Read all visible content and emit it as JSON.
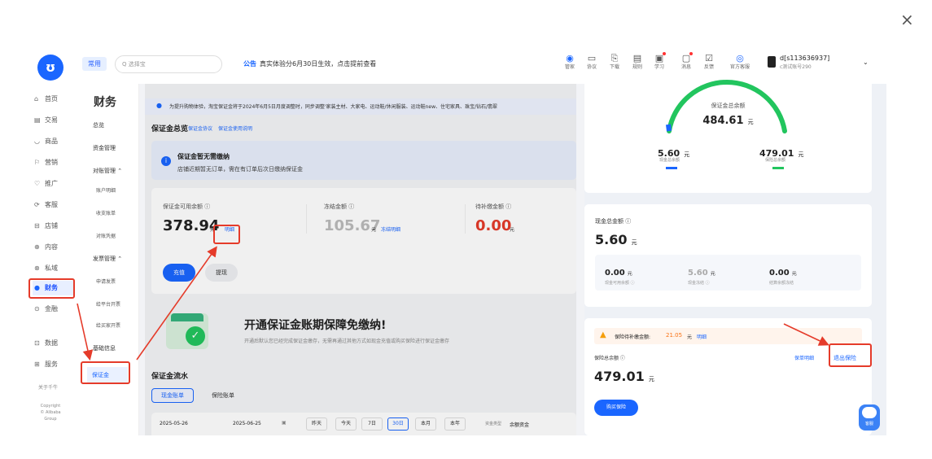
{
  "dialog": {
    "close_label": "×"
  },
  "topbar": {
    "logo": "ʊ",
    "chip": "常用",
    "search_placeholder": "Q 选择宝",
    "notice_label": "公告",
    "notice_text": "真实体验分6月30日生效，点击提前查看",
    "icons": [
      {
        "glyph": "◉",
        "label": "管家",
        "icon": "steward-icon",
        "dot": false,
        "color": "#1a66ff"
      },
      {
        "glyph": "▭",
        "label": "协议",
        "icon": "agreement-icon",
        "dot": false
      },
      {
        "glyph": "⎘",
        "label": "下载",
        "icon": "download-icon",
        "dot": false
      },
      {
        "glyph": "▤",
        "label": "规则",
        "icon": "rules-icon",
        "dot": false
      },
      {
        "glyph": "▣",
        "label": "学习",
        "icon": "learn-icon",
        "dot": true
      },
      {
        "glyph": "▢",
        "label": "消息",
        "icon": "message-icon",
        "dot": true
      },
      {
        "glyph": "☑",
        "label": "反馈",
        "icon": "feedback-icon",
        "dot": false
      },
      {
        "glyph": "◎",
        "label": "官方客服",
        "icon": "service-icon",
        "dot": false,
        "color": "#1a66ff"
      }
    ],
    "user_name": "d[s113636937]",
    "user_sub": "c测试账号290"
  },
  "leftnav": [
    {
      "icon": "⌂",
      "label": "首页",
      "name": "home-icon"
    },
    {
      "icon": "▤",
      "label": "交易",
      "name": "trade-icon"
    },
    {
      "icon": "◡",
      "label": "商品",
      "name": "goods-icon"
    },
    {
      "icon": "⚐",
      "label": "营销",
      "name": "marketing-icon"
    },
    {
      "icon": "♡",
      "label": "推广",
      "name": "promote-icon"
    },
    {
      "icon": "⟳",
      "label": "客服",
      "name": "cs-icon"
    },
    {
      "icon": "⊟",
      "label": "店铺",
      "name": "shop-icon"
    },
    {
      "icon": "⊕",
      "label": "内容",
      "name": "content-icon"
    },
    {
      "icon": "⊗",
      "label": "私域",
      "name": "private-icon"
    },
    {
      "icon": "●",
      "label": "财务",
      "name": "finance-icon",
      "active": true
    },
    {
      "icon": "⊙",
      "label": "金融",
      "name": "finance2-icon"
    },
    {
      "icon": "⊡",
      "label": "数据",
      "name": "data-icon"
    },
    {
      "icon": "⊞",
      "label": "服务",
      "name": "service2-icon"
    }
  ],
  "leftnav_footer": {
    "about": "关于千牛",
    "copyright": "Copyright",
    "alibaba": "© Alibaba",
    "group": "Group"
  },
  "subnav": {
    "title": "财务",
    "items": [
      "总览",
      "资金管理",
      "对账管理 ⌃",
      "账户明细",
      "收支账单",
      "对账凭据",
      "发票管理 ⌃",
      "申请发票",
      "给平台开票",
      "给买家开票",
      "基础信息",
      "保证金"
    ]
  },
  "main": {
    "banner": "为提升购物体验，淘宝保证金将于2024年6月5日月度调整时，同步调整'家装主材、大家电、运动鞋/休闲服装、运动鞋new、住宅家具、珠宝/钻石/翡翠",
    "section_title": "保证金总览",
    "links": [
      "保证金协议",
      "保证金使用说明"
    ],
    "info_title": "保证金暂无需缴纳",
    "info_text": "店铺近期暂无订单，需在有订单后次日缴纳保证金",
    "m1_label": "保证金可用余额 ⓘ",
    "m1_value": "378.94",
    "m1_unit": "元",
    "m1_link": "明细",
    "m2_label": "冻结金额 ⓘ",
    "m2_value": "105.67",
    "m2_unit": "元",
    "m2_link": "冻结明细",
    "m3_label": "待补缴金额 ⓘ",
    "m3_value": "0.00",
    "m3_unit": "元",
    "btn_recharge": "充值",
    "btn_withdraw": "提现",
    "promo_title": "开通保证金账期保障免缴纳!",
    "promo_text": "开通后默认您已经完成保证金缴存，无需再通过其他方式如现金充值或购买保险进行保证金缴存",
    "flow_title": "保证金流水",
    "tab1": "现金账单",
    "tab2": "保险账单",
    "date_from": "2025-05-26",
    "date_to": "2025-06-25",
    "quick": [
      "昨天",
      "今天",
      "7日",
      "30日",
      "本月",
      "本年"
    ],
    "type_label": "资金类型",
    "type_value": "余额资金"
  },
  "right": {
    "gauge_label": "保证金总余额",
    "gauge_value": "484.61",
    "unit": "元",
    "cash_val": "5.60",
    "cash_lbl": "现金总余额",
    "ins_val": "479.01",
    "ins_lbl": "保险总余额",
    "cash_title": "现金总金额 ⓘ",
    "cash_total": "5.60",
    "c_items": [
      {
        "v": "0.00",
        "l": "现金可用余额 ⓘ"
      },
      {
        "v": "5.60",
        "l": "现金冻结 ⓘ"
      },
      {
        "v": "0.00",
        "l": "结算余额冻结"
      }
    ],
    "warn_label": "保险待补缴金额:",
    "warn_value": "21.05",
    "warn_link": "明细",
    "ins_title": "保险总余额 ⓘ",
    "ins_detail": "保单明细",
    "ins_exit": "退出保险",
    "ins_total": "479.01",
    "ins_buy": "购买保险",
    "bot_label": "客服"
  },
  "colors": {
    "accent": "#1a66ff",
    "highlight": "#e53b2a",
    "gauge": "#22c55e"
  }
}
